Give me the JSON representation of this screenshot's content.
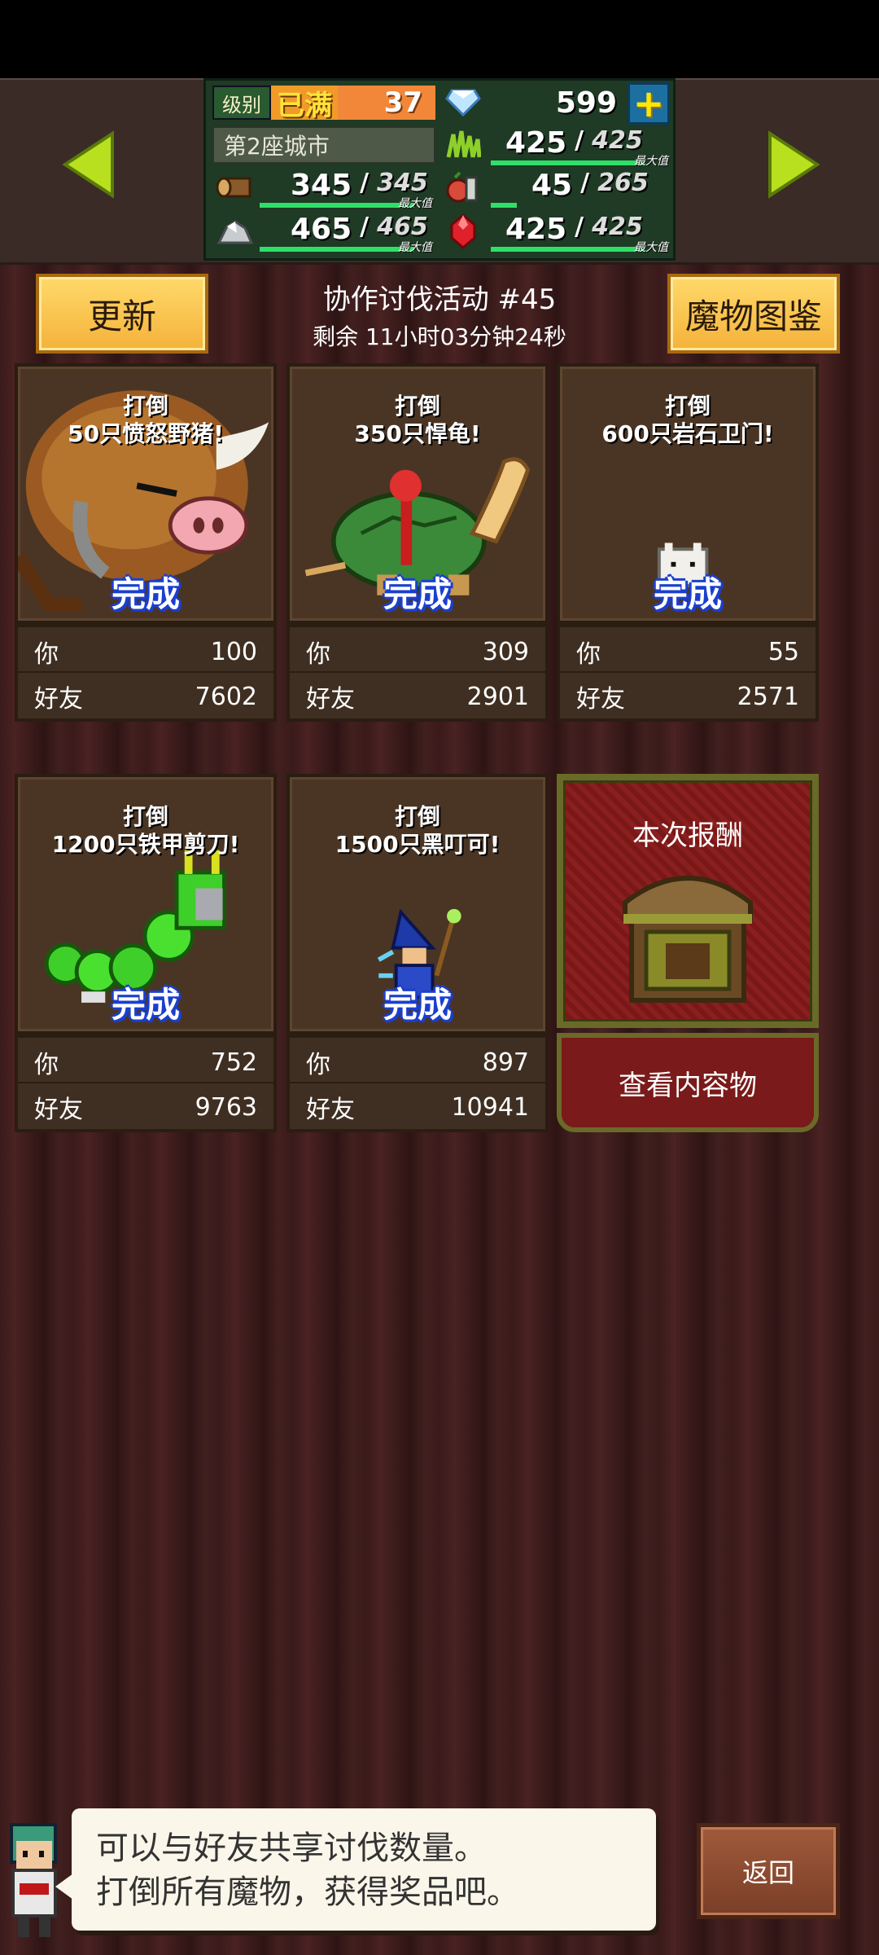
{
  "header": {
    "level_label": "级别",
    "level_status": "已满",
    "level_value": "37",
    "gems": "599",
    "city_label": "第2座城市",
    "max_tag": "最大值",
    "resources": [
      {
        "name": "grass",
        "current": "425",
        "max": "425",
        "fill": 1.0
      },
      {
        "name": "wood",
        "current": "345",
        "max": "345",
        "fill": 1.0
      },
      {
        "name": "food",
        "current": "45",
        "max": "265",
        "fill": 0.17
      },
      {
        "name": "ore",
        "current": "465",
        "max": "465",
        "fill": 1.0
      },
      {
        "name": "ruby",
        "current": "425",
        "max": "425",
        "fill": 1.0
      }
    ]
  },
  "controls": {
    "refresh": "更新",
    "bestiary": "魔物图鉴",
    "back": "返回"
  },
  "event": {
    "title": "协作讨伐活动 #45",
    "remaining": "剩余 11小时03分钟24秒"
  },
  "labels": {
    "you": "你",
    "friends": "好友",
    "complete": "完成"
  },
  "quests": [
    {
      "line1": "打倒",
      "line2": "50只愤怒野猪!",
      "you": "100",
      "friends": "7602",
      "monster": "boar-icon"
    },
    {
      "line1": "打倒",
      "line2": "350只悍龟!",
      "you": "309",
      "friends": "2901",
      "monster": "turtle-icon"
    },
    {
      "line1": "打倒",
      "line2": "600只岩石卫门!",
      "you": "55",
      "friends": "2571",
      "monster": "rock-golem-icon"
    },
    {
      "line1": "打倒",
      "line2": "1200只铁甲剪刀!",
      "you": "752",
      "friends": "9763",
      "monster": "caterpillar-icon"
    },
    {
      "line1": "打倒",
      "line2": "1500只黑叮可!",
      "you": "897",
      "friends": "10941",
      "monster": "wizard-icon"
    }
  ],
  "reward": {
    "title": "本次报酬",
    "view": "查看内容物"
  },
  "dialog": {
    "line1": "可以与好友共享讨伐数量。",
    "line2": "打倒所有魔物，获得奖品吧。"
  }
}
